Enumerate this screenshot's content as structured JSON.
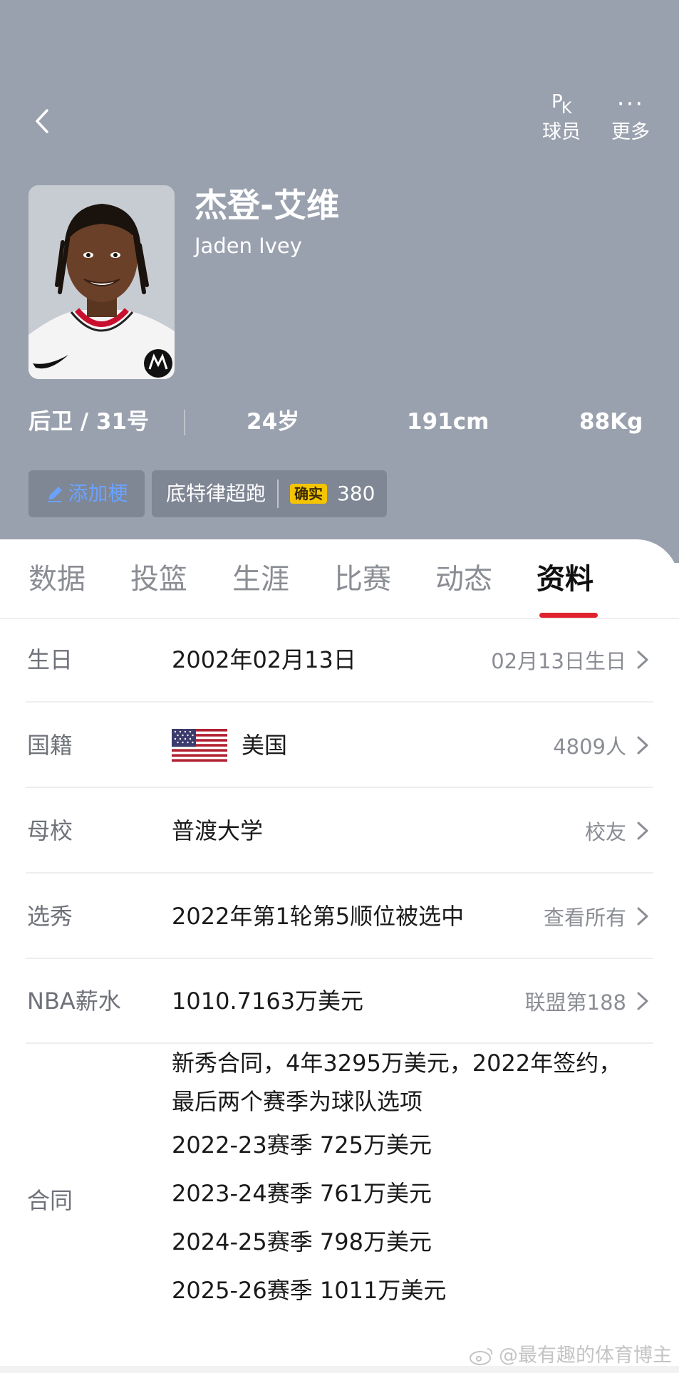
{
  "header": {
    "pk_label": "球员",
    "pk_icon_p": "P",
    "pk_icon_k": "K",
    "more_label": "更多"
  },
  "player": {
    "name_cn": "杰登-艾维",
    "name_en": "Jaden Ivey",
    "position_number": "后卫 / 31号",
    "age": "24岁",
    "height": "191cm",
    "weight": "88Kg"
  },
  "tags": {
    "add_label": "添加梗",
    "tag_text": "底特律超跑",
    "confirm_badge": "确实",
    "confirm_count": "380"
  },
  "tabs": [
    {
      "label": "数据"
    },
    {
      "label": "投篮"
    },
    {
      "label": "生涯"
    },
    {
      "label": "比赛"
    },
    {
      "label": "动态"
    },
    {
      "label": "资料"
    }
  ],
  "active_tab": "资料",
  "profile": {
    "birthday": {
      "label": "生日",
      "value": "2002年02月13日",
      "right": "02月13日生日"
    },
    "nationality": {
      "label": "国籍",
      "value": "美国",
      "right": "4809人"
    },
    "college": {
      "label": "母校",
      "value": "普渡大学",
      "right": "校友"
    },
    "draft": {
      "label": "选秀",
      "value": "2022年第1轮第5顺位被选中",
      "right": "查看所有"
    },
    "salary": {
      "label": "NBA薪水",
      "value": "1010.7163万美元",
      "right": "联盟第188"
    }
  },
  "contract": {
    "label": "合同",
    "summary_line1": "新秀合同，4年3295万美元，2022年签约，",
    "summary_line2": "最后两个赛季为球队选项",
    "seasons": [
      {
        "text": "2022-23赛季 725万美元"
      },
      {
        "text": "2023-24赛季 761万美元"
      },
      {
        "text": "2024-25赛季 798万美元"
      },
      {
        "text": "2025-26赛季 1011万美元"
      }
    ]
  },
  "watermark": "@最有趣的体育博主",
  "colors": {
    "header_bg": "#9aa1ae",
    "active_underline": "#e0222f",
    "add_tag_text": "#6aa3ff",
    "confirm_badge": "#f5c400"
  }
}
